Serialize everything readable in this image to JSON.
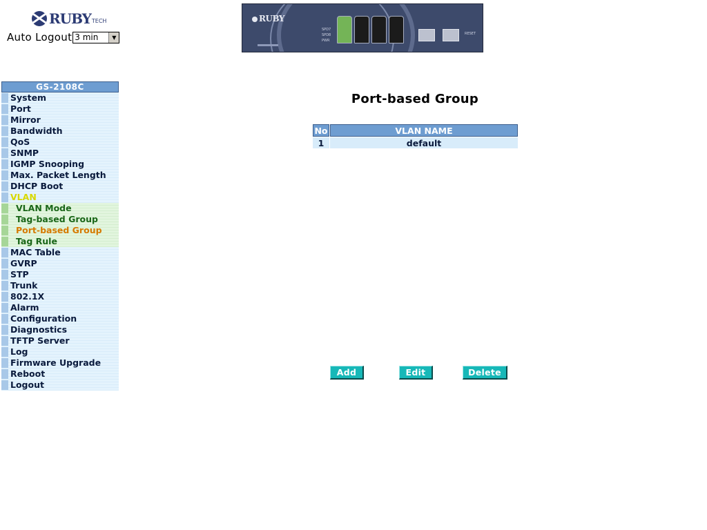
{
  "header": {
    "logo_text": "RUBY",
    "logo_suffix": "TECH",
    "auto_logout_label": "Auto Logout",
    "auto_logout_value": "3 min"
  },
  "device_panel": {
    "logo_text": "RUBY",
    "led_labels": [
      "SPD7",
      "SPD8",
      "PWR"
    ],
    "port_count": 6,
    "active_port": 1,
    "sfp_label": "SFP",
    "reset_label": "RESET"
  },
  "sidebar": {
    "title": "GS-2108C",
    "items": [
      {
        "label": "System"
      },
      {
        "label": "Port"
      },
      {
        "label": "Mirror"
      },
      {
        "label": "Bandwidth"
      },
      {
        "label": "QoS"
      },
      {
        "label": "SNMP"
      },
      {
        "label": "IGMP Snooping"
      },
      {
        "label": "Max. Packet Length"
      },
      {
        "label": "DHCP Boot"
      },
      {
        "label": "VLAN"
      },
      {
        "label": "VLAN Mode"
      },
      {
        "label": "Tag-based Group"
      },
      {
        "label": "Port-based Group"
      },
      {
        "label": "Tag Rule"
      },
      {
        "label": "MAC Table"
      },
      {
        "label": "GVRP"
      },
      {
        "label": "STP"
      },
      {
        "label": "Trunk"
      },
      {
        "label": "802.1X"
      },
      {
        "label": "Alarm"
      },
      {
        "label": "Configuration"
      },
      {
        "label": "Diagnostics"
      },
      {
        "label": "TFTP Server"
      },
      {
        "label": "Log"
      },
      {
        "label": "Firmware Upgrade"
      },
      {
        "label": "Reboot"
      },
      {
        "label": "Logout"
      }
    ]
  },
  "main": {
    "title": "Port-based Group",
    "table": {
      "headers": [
        "No",
        "VLAN NAME"
      ],
      "rows": [
        [
          "1",
          "default"
        ]
      ]
    },
    "buttons": {
      "add": "Add",
      "edit": "Edit",
      "delete": "Delete"
    }
  }
}
